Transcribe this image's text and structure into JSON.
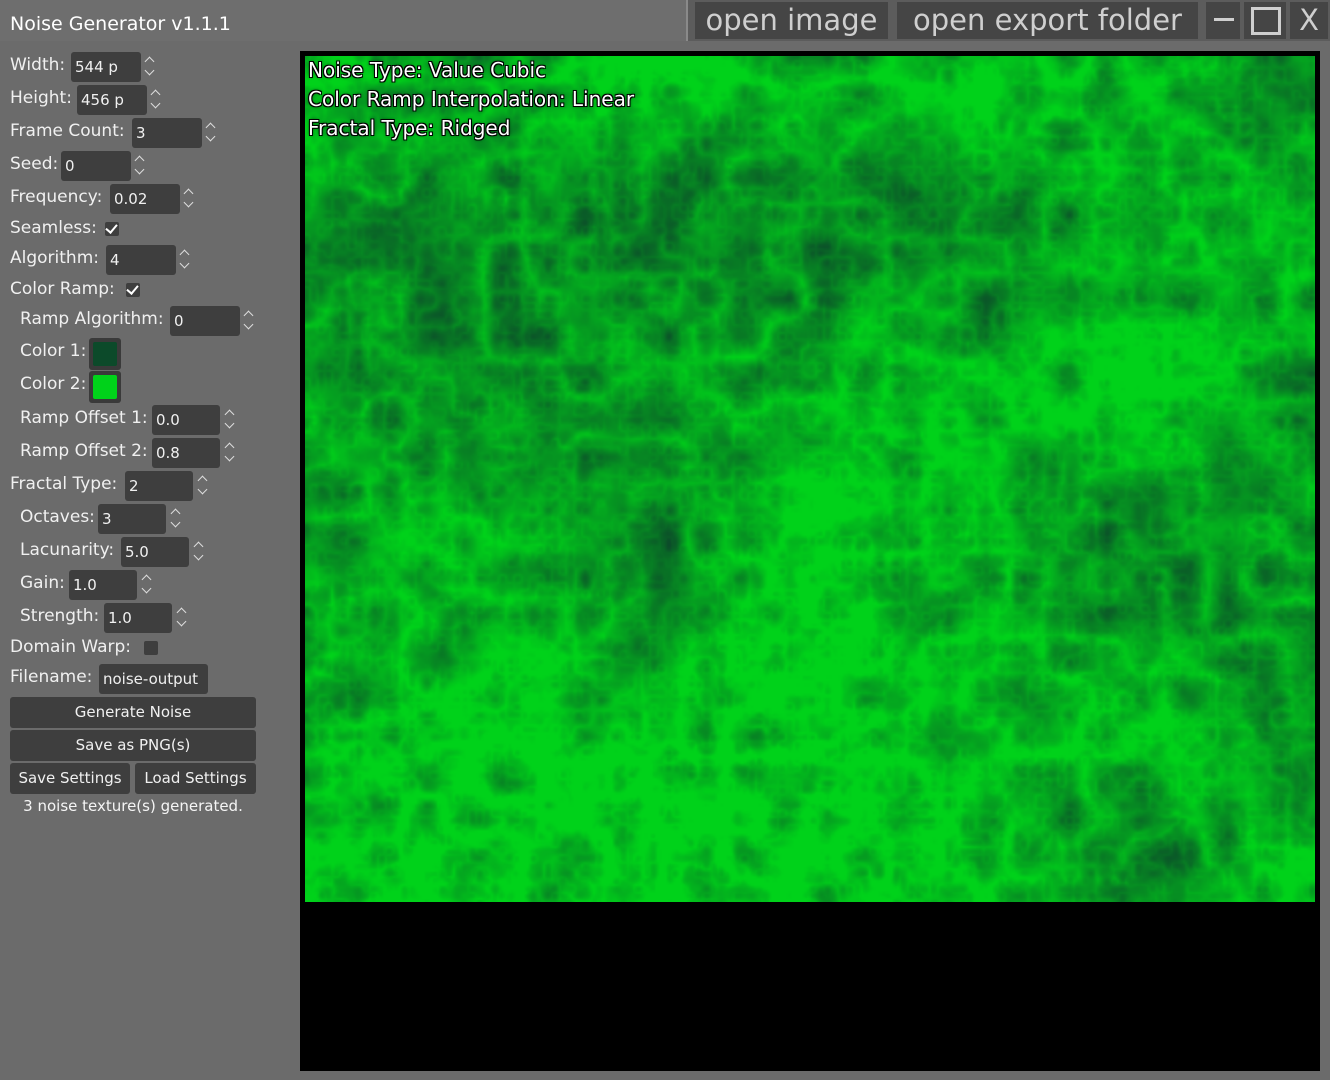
{
  "window": {
    "title": "Noise Generator v1.1.1",
    "open_image_label": "open image",
    "open_export_folder_label": "open export folder",
    "close_label": "X"
  },
  "settings": {
    "width": {
      "label": "Width:",
      "value": "544 p"
    },
    "height": {
      "label": "Height:",
      "value": "456 p"
    },
    "frame_count": {
      "label": "Frame Count:",
      "value": "3"
    },
    "seed": {
      "label": "Seed:",
      "value": "0"
    },
    "frequency": {
      "label": "Frequency:",
      "value": "0.02"
    },
    "seamless": {
      "label": "Seamless:",
      "checked": true
    },
    "algorithm": {
      "label": "Algorithm:",
      "value": "4"
    },
    "color_ramp": {
      "label": "Color Ramp:",
      "checked": true
    },
    "ramp_algorithm": {
      "label": "Ramp Algorithm:",
      "value": "0"
    },
    "color1": {
      "label": "Color 1:",
      "color": "#0c4a2a"
    },
    "color2": {
      "label": "Color 2:",
      "color": "#00d21a"
    },
    "ramp_offset1": {
      "label": "Ramp Offset 1:",
      "value": "0.0"
    },
    "ramp_offset2": {
      "label": "Ramp Offset 2:",
      "value": "0.8"
    },
    "fractal_type": {
      "label": "Fractal Type:",
      "value": "2"
    },
    "octaves": {
      "label": "Octaves:",
      "value": "3"
    },
    "lacunarity": {
      "label": "Lacunarity:",
      "value": "5.0"
    },
    "gain": {
      "label": "Gain:",
      "value": "1.0"
    },
    "strength": {
      "label": "Strength:",
      "value": "1.0"
    },
    "domain_warp": {
      "label": "Domain Warp:",
      "checked": false
    },
    "filename": {
      "label": "Filename:",
      "value": "noise-output"
    }
  },
  "actions": {
    "generate": "Generate Noise",
    "save_png": "Save as PNG(s)",
    "save_settings": "Save Settings",
    "load_settings": "Load Settings"
  },
  "status": "3 noise texture(s) generated.",
  "preview": {
    "noise_type": "Noise Type: Value Cubic",
    "interpolation": "Color Ramp Interpolation: Linear",
    "fractal_type": "Fractal Type: Ridged"
  }
}
